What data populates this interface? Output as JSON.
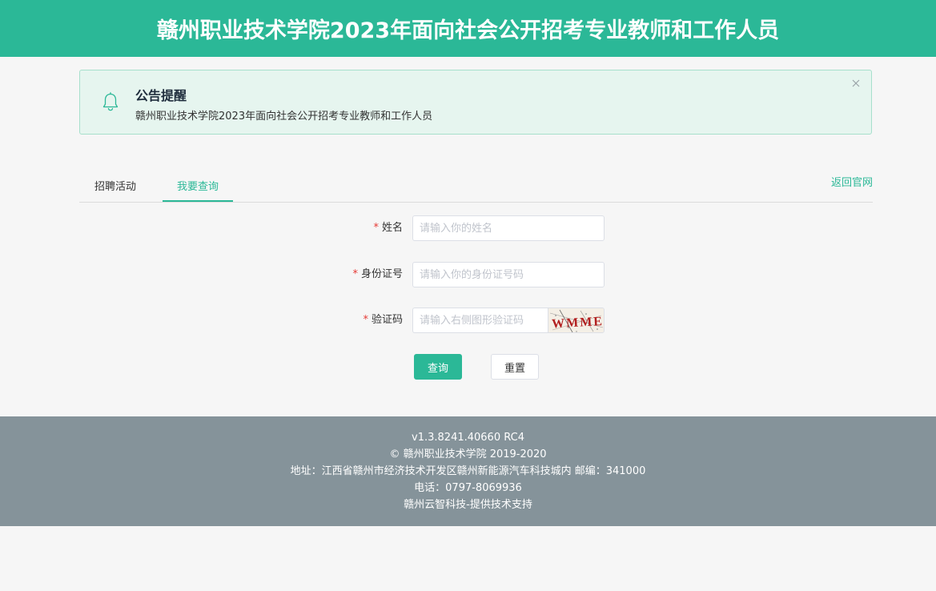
{
  "header": {
    "title": "赣州职业技术学院2023年面向社会公开招考专业教师和工作人员",
    "color": "#2bb897"
  },
  "notice": {
    "icon": "bell-icon",
    "title": "公告提醒",
    "text": "赣州职业技术学院2023年面向社会公开招考专业教师和工作人员",
    "close_icon": "close-icon"
  },
  "tabs": [
    {
      "label": "招聘活动",
      "active": false
    },
    {
      "label": "我要查询",
      "active": true
    }
  ],
  "back_link": "返回官网",
  "form": {
    "required_mark": "*",
    "name": {
      "label": "姓名",
      "placeholder": "请输入你的姓名",
      "value": ""
    },
    "id_number": {
      "label": "身份证号",
      "placeholder": "请输入你的身份证号码",
      "value": ""
    },
    "captcha": {
      "label": "验证码",
      "placeholder": "请输入右侧图形验证码",
      "value": "",
      "image_text": "WMME"
    },
    "submit_label": "查询",
    "reset_label": "重置"
  },
  "footer": {
    "version": "v1.3.8241.40660 RC4",
    "copyright": "© 赣州职业技术学院 2019-2020",
    "address": "地址：江西省赣州市经济技术开发区赣州新能源汽车科技城内 邮编：341000",
    "phone": "电话：0797-8069936",
    "support": "赣州云智科技-提供技术支持"
  }
}
